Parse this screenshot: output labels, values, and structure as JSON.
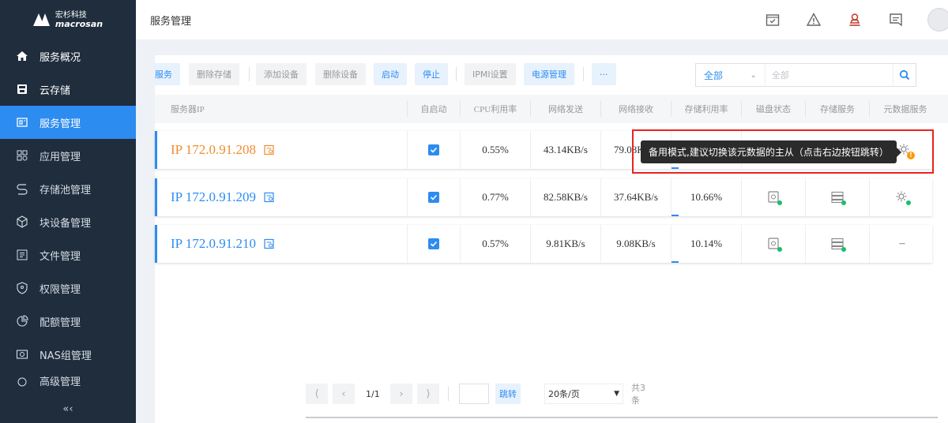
{
  "logo": {
    "cn": "宏杉科技",
    "en": "macrosan"
  },
  "sidebar": {
    "items": [
      {
        "label": "服务概况",
        "icon": "home-icon"
      },
      {
        "label": "云存储",
        "icon": "cloud-storage-icon"
      },
      {
        "label": "服务管理",
        "icon": "service-icon",
        "active": true
      },
      {
        "label": "应用管理",
        "icon": "app-icon"
      },
      {
        "label": "存储池管理",
        "icon": "pool-icon"
      },
      {
        "label": "块设备管理",
        "icon": "block-icon"
      },
      {
        "label": "文件管理",
        "icon": "file-icon"
      },
      {
        "label": "权限管理",
        "icon": "permission-icon"
      },
      {
        "label": "配额管理",
        "icon": "quota-icon"
      },
      {
        "label": "NAS组管理",
        "icon": "nas-icon"
      },
      {
        "label": "高级管理",
        "icon": "advanced-icon"
      }
    ],
    "collapse_label": "«‹"
  },
  "header": {
    "title": "服务管理"
  },
  "toolbar": {
    "buttons": [
      "服务",
      "删除存储",
      "添加设备",
      "删除设备",
      "启动",
      "停止",
      "IPMI设置",
      "电源管理",
      "···"
    ],
    "filter_select": "全部",
    "filter_placeholder": "全部"
  },
  "table": {
    "columns": [
      "服务器IP",
      "自启动",
      "CPU利用率",
      "网络发送",
      "网络接收",
      "存储利用率",
      "磁盘状态",
      "存储服务",
      "元数据服务"
    ],
    "rows": [
      {
        "ip": "IP 172.0.91.208",
        "autostart": true,
        "cpu": "0.55%",
        "send": "43.14KB/s",
        "recv": "79.08K",
        "storage": "",
        "storage_pct": 0.1,
        "meta_status": "warning"
      },
      {
        "ip": "IP 172.0.91.209",
        "autostart": true,
        "cpu": "0.77%",
        "send": "82.58KB/s",
        "recv": "37.64KB/s",
        "storage": "10.66%",
        "storage_pct": 0.1066,
        "meta_status": "ok"
      },
      {
        "ip": "IP 172.0.91.210",
        "autostart": true,
        "cpu": "0.57%",
        "send": "9.81KB/s",
        "recv": "9.08KB/s",
        "storage": "10.14%",
        "storage_pct": 0.1014,
        "meta_status": "none",
        "meta_text": "–"
      }
    ]
  },
  "tooltip": "备用模式,建议切换该元数据的主从（点击右边按钮跳转）",
  "pager": {
    "first": "⟨",
    "prev": "‹",
    "page_info": "1/1",
    "next": "›",
    "last": "⟩",
    "jump": "跳转",
    "page_size": "20条/页",
    "total": "共3条"
  },
  "colors": {
    "accent": "#2d8cf0",
    "sidebar_bg": "#1f2d3d",
    "warning": "#ff9900",
    "highlight": "#e8231f",
    "ip_orange": "#f08c2d"
  }
}
